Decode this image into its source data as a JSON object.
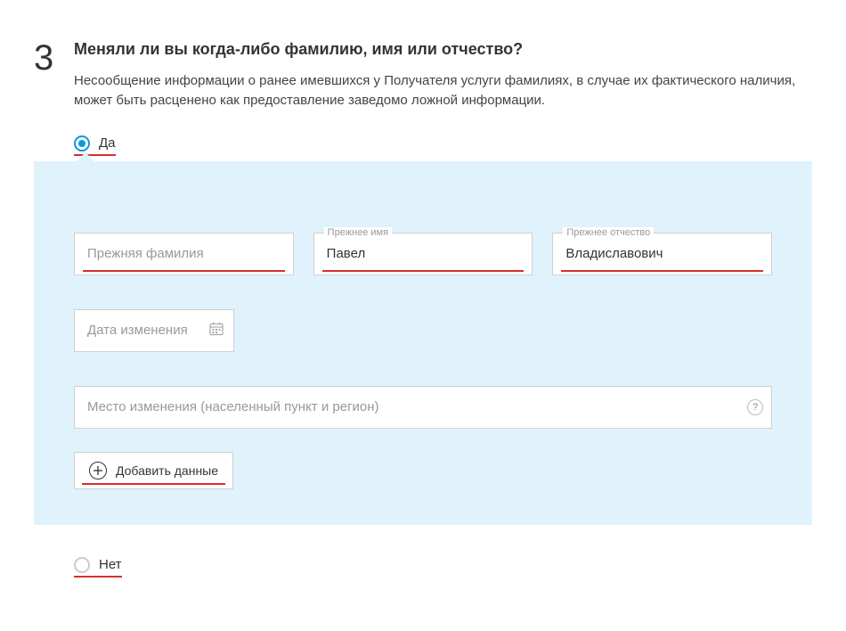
{
  "step": "3",
  "question": {
    "title": "Меняли ли вы когда-либо фамилию, имя или отчество?",
    "description": "Несообщение информации о ранее имевшихся у Получателя услуги фамилиях, в случае их фактического наличия, может быть расценено как предоставление заведомо ложной информации."
  },
  "radio": {
    "yes": "Да",
    "no": "Нет"
  },
  "fields": {
    "surname": {
      "placeholder": "Прежняя фамилия",
      "value": ""
    },
    "firstname": {
      "label": "Прежнее имя",
      "value": "Павел"
    },
    "patronymic": {
      "label": "Прежнее отчество",
      "value": "Владиславович"
    },
    "date": {
      "placeholder": "Дата изменения",
      "value": ""
    },
    "place": {
      "placeholder": "Место изменения (населенный пункт и регион)",
      "value": ""
    }
  },
  "add_button": "Добавить данные",
  "help_char": "?"
}
